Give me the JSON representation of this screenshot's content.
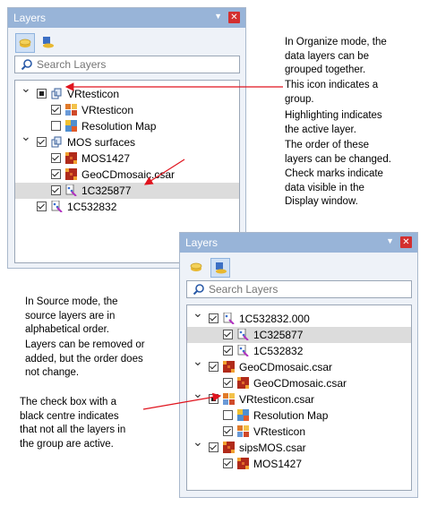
{
  "organize_panel": {
    "title": "Layers",
    "search_placeholder": "Search Layers",
    "rows": [
      {
        "label": "VRtesticon",
        "level": 0,
        "expander": "open",
        "check": "partial",
        "icon": "group-icon"
      },
      {
        "label": "VRtesticon",
        "level": 1,
        "expander": "",
        "check": "checked",
        "icon": "mosaic-icon"
      },
      {
        "label": "Resolution Map",
        "level": 1,
        "expander": "",
        "check": "unchecked",
        "icon": "resolution-map-icon"
      },
      {
        "label": "MOS surfaces",
        "level": 0,
        "expander": "open",
        "check": "checked",
        "icon": "group-icon"
      },
      {
        "label": "MOS1427",
        "level": 1,
        "expander": "",
        "check": "checked",
        "icon": "grid-icon"
      },
      {
        "label": "GeoCDmosaic.csar",
        "level": 1,
        "expander": "",
        "check": "checked",
        "icon": "grid-icon"
      },
      {
        "label": "1C325877",
        "level": 1,
        "expander": "",
        "check": "checked",
        "icon": "pointcloud-icon",
        "selected": true
      },
      {
        "label": "1C532832",
        "level": 0,
        "expander": "",
        "check": "checked",
        "icon": "pointcloud-icon"
      }
    ]
  },
  "source_panel": {
    "title": "Layers",
    "search_placeholder": "Search Layers",
    "rows": [
      {
        "label": "1C532832.000",
        "level": 0,
        "expander": "open",
        "check": "checked",
        "icon": "source-file-icon"
      },
      {
        "label": "1C325877",
        "level": 1,
        "expander": "",
        "check": "checked",
        "icon": "pointcloud-icon",
        "selected": true
      },
      {
        "label": "1C532832",
        "level": 1,
        "expander": "",
        "check": "checked",
        "icon": "pointcloud-icon"
      },
      {
        "label": "GeoCDmosaic.csar",
        "level": 0,
        "expander": "open",
        "check": "checked",
        "icon": "grid-icon"
      },
      {
        "label": "GeoCDmosaic.csar",
        "level": 1,
        "expander": "",
        "check": "checked",
        "icon": "grid-icon"
      },
      {
        "label": "VRtesticon.csar",
        "level": 0,
        "expander": "open",
        "check": "partial",
        "icon": "mosaic-icon"
      },
      {
        "label": "Resolution Map",
        "level": 1,
        "expander": "",
        "check": "unchecked",
        "icon": "resolution-map-icon"
      },
      {
        "label": "VRtesticon",
        "level": 1,
        "expander": "",
        "check": "checked",
        "icon": "mosaic-icon"
      },
      {
        "label": "sipsMOS.csar",
        "level": 0,
        "expander": "open",
        "check": "checked",
        "icon": "grid-icon"
      },
      {
        "label": "MOS1427",
        "level": 1,
        "expander": "",
        "check": "checked",
        "icon": "grid-icon"
      }
    ]
  },
  "annotations": {
    "organize_mode": "In Organize mode, the\ndata layers can be\ngrouped together.",
    "group_icon": "This icon indicates a\ngroup.",
    "active_layer": "Highlighting indicates\nthe active layer.",
    "order_change": "The order of these\nlayers can be changed.",
    "check_marks": "Check marks indicate\ndata visible in the\nDisplay window.",
    "source_mode": "In Source mode, the\nsource layers are in\nalphabetical order.",
    "removed_added": "Layers can be removed or\nadded, but the order does\nnot change.",
    "black_centre": "The check box with a\nblack centre indicates\nthat not all the layers in\nthe group are active."
  },
  "colors": {
    "titlebar": "#98b4d8",
    "arrow": "#e0141e",
    "selection": "#dcdcdc",
    "close": "#d32f2f"
  }
}
